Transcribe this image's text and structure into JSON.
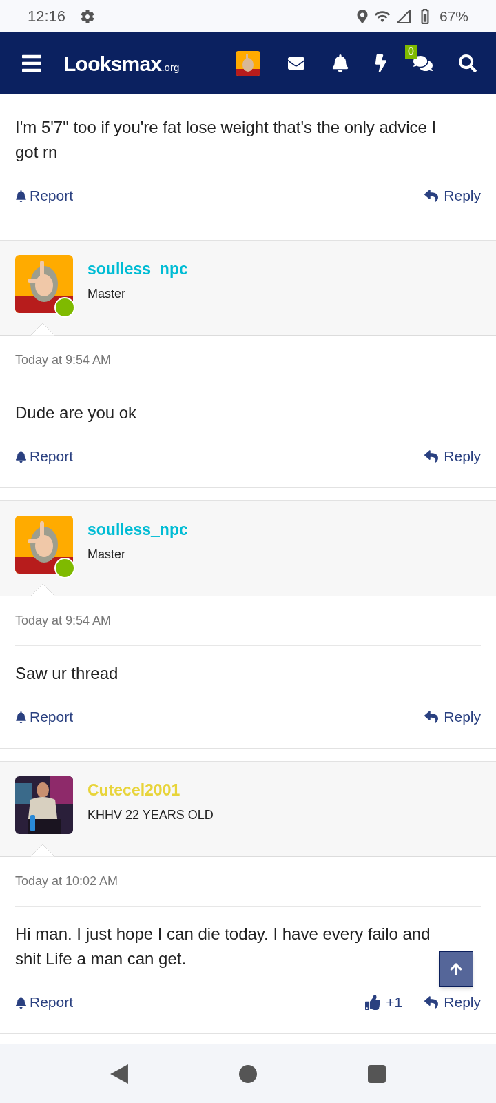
{
  "status_bar": {
    "time": "12:16",
    "battery": "67%"
  },
  "header": {
    "logo": "Looksmax",
    "logo_suffix": ".org",
    "conversations_badge": "0"
  },
  "posts": [
    {
      "kind": "partial",
      "message": "I'm 5'7\" too if you're fat lose weight that's the only advice I got rn",
      "report": "Report",
      "reply": "Reply"
    },
    {
      "kind": "full",
      "author": {
        "name": "soulless_npc",
        "color": "#00bcd4",
        "title": "Master",
        "online": true
      },
      "date": "Today at 9:54 AM",
      "message": "Dude are you ok",
      "report": "Report",
      "reply": "Reply"
    },
    {
      "kind": "full",
      "author": {
        "name": "soulless_npc",
        "color": "#00bcd4",
        "title": "Master",
        "online": true
      },
      "date": "Today at 9:54 AM",
      "message": "Saw ur thread",
      "report": "Report",
      "reply": "Reply"
    },
    {
      "kind": "full",
      "author": {
        "name": "Cutecel2001",
        "color": "#e8d43a",
        "title": "KHHV 22 YEARS OLD",
        "online": false
      },
      "date": "Today at 10:02 AM",
      "message": "Hi man. I just hope I can die today. I have every failo and shit Life a man can get.",
      "likes": "+1",
      "report": "Report",
      "reply": "Reply"
    }
  ]
}
